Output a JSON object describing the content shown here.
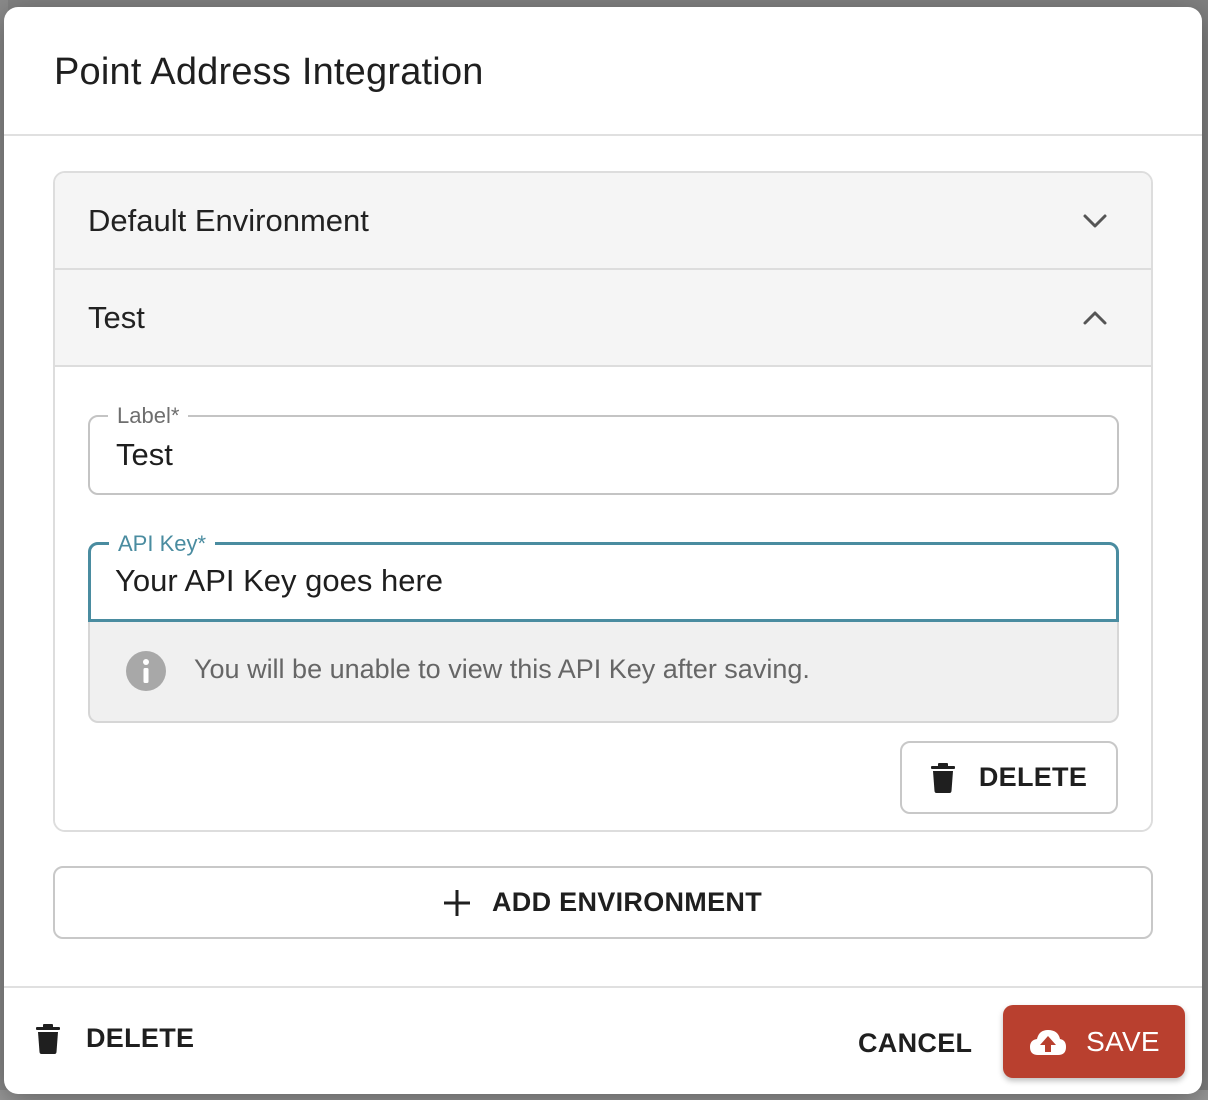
{
  "dialog": {
    "title": "Point Address Integration"
  },
  "environments": [
    {
      "label": "Default Environment",
      "expanded": false,
      "chevron": "chevron-down-icon"
    },
    {
      "label": "Test",
      "expanded": true,
      "chevron": "chevron-up-icon"
    }
  ],
  "form": {
    "label_field": {
      "legend": "Label*",
      "value": "Test"
    },
    "api_key_field": {
      "legend": "API Key*",
      "value": "Your API Key goes here"
    },
    "note": {
      "icon": "info-icon",
      "text": "You will be unable to view this API Key after saving."
    },
    "delete_button": {
      "label": "DELETE",
      "icon": "trash-icon"
    }
  },
  "add_environment": {
    "label": "ADD ENVIRONMENT",
    "icon": "plus-icon"
  },
  "footer": {
    "delete_label": "DELETE",
    "cancel_label": "CANCEL",
    "save_label": "SAVE",
    "save_icon": "cloud-upload-icon"
  },
  "colors": {
    "accent": "#4a8ca0",
    "save_button": "#b9402f",
    "header_bg": "#f5f5f5",
    "note_bg": "#f0f0f0"
  }
}
